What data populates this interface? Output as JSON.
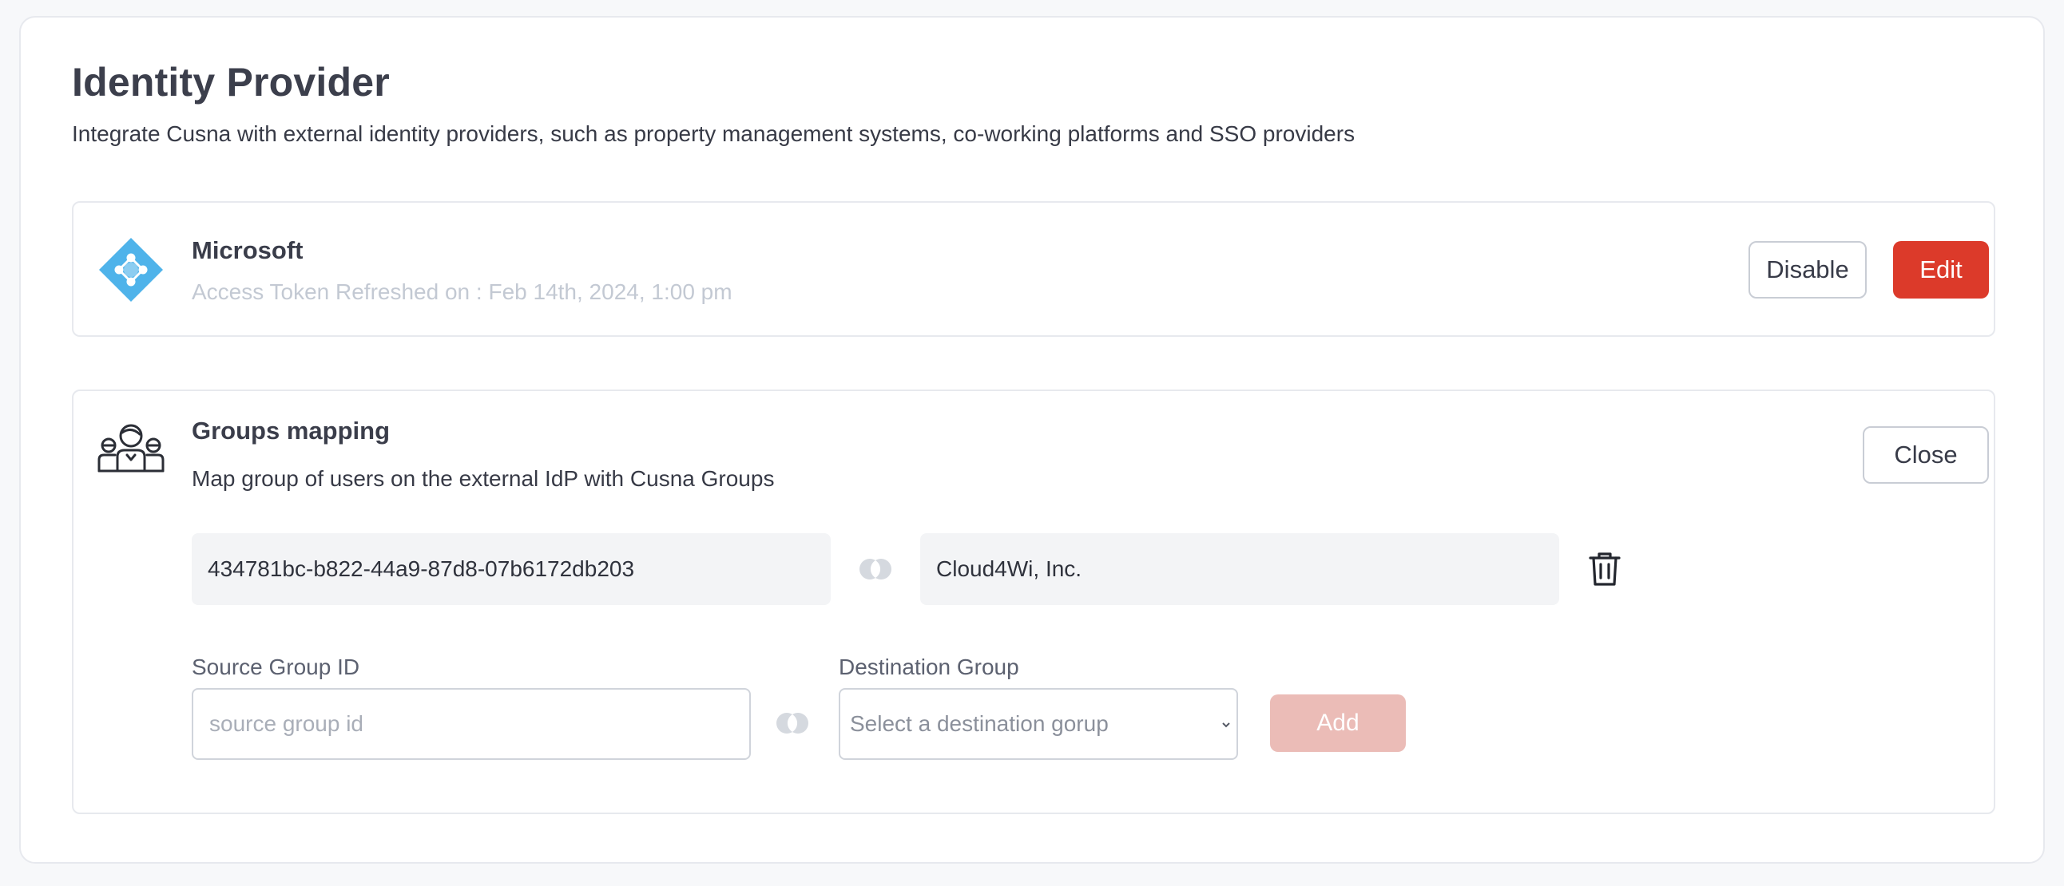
{
  "page": {
    "title": "Identity Provider",
    "subtitle": "Integrate Cusna with external identity providers, such as property management systems, co-working platforms and SSO providers"
  },
  "provider": {
    "name": "Microsoft",
    "status": "Access Token Refreshed on : Feb 14th, 2024, 1:00 pm",
    "logo_icon": "azure-ad-logo-icon",
    "disable_label": "Disable",
    "edit_label": "Edit"
  },
  "groups_mapping": {
    "title": "Groups mapping",
    "description": "Map group of users on the external IdP with Cusna Groups",
    "icon": "users-group-icon",
    "close_label": "Close",
    "mappings": [
      {
        "source": "434781bc-b822-44a9-87d8-07b6172db203",
        "destination": "Cloud4Wi, Inc."
      }
    ],
    "form": {
      "source_label": "Source Group ID",
      "source_placeholder": "source group id",
      "destination_label": "Destination Group",
      "destination_placeholder": "Select a destination gorup",
      "add_label": "Add"
    }
  },
  "colors": {
    "accent": "#dc3a2a",
    "accent_disabled": "#ebbcb7",
    "logo_blue": "#4fb3ea",
    "muted_text": "#c3c9d3"
  }
}
